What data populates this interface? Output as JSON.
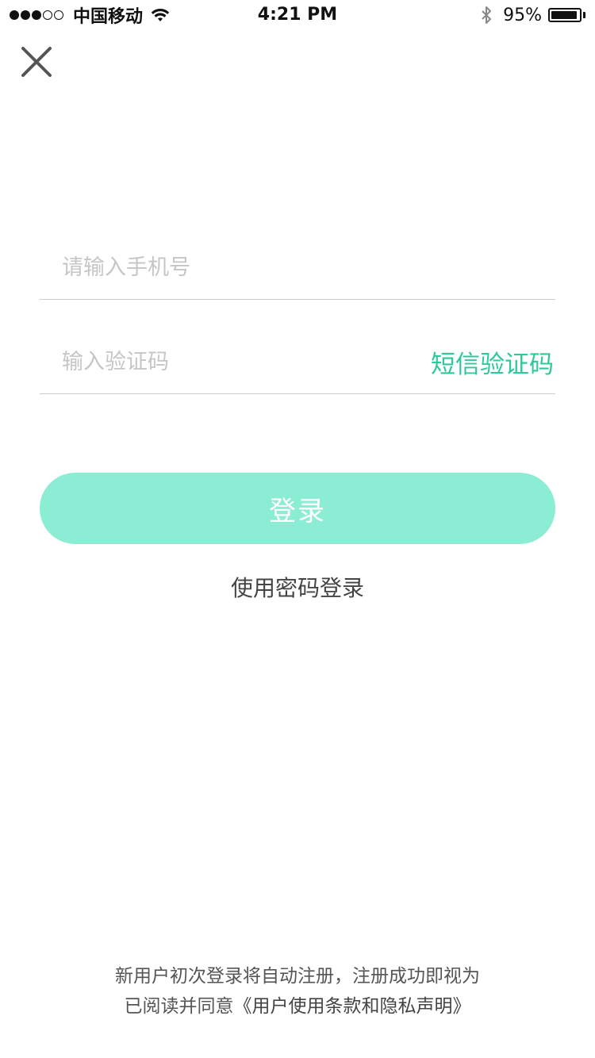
{
  "status_bar": {
    "carrier": "中国移动",
    "time": "4:21 PM",
    "battery_percent": "95%",
    "battery_level": 0.95,
    "signal_bars_filled": 3,
    "signal_bars_total": 5
  },
  "header": {
    "close_icon": "close-icon"
  },
  "form": {
    "phone_placeholder": "请输入手机号",
    "phone_value": "",
    "code_placeholder": "输入验证码",
    "code_value": "",
    "sms_code_label": "短信验证码",
    "login_label": "登录",
    "password_login_label": "使用密码登录"
  },
  "footer": {
    "agreement_line1": "新用户初次登录将自动注册，注册成功即视为",
    "agreement_prefix": "已阅读并同意",
    "terms_link": "《用户使用条款和隐私声明》"
  },
  "colors": {
    "accent": "#2ec89a",
    "button_bg": "#8bedd3",
    "placeholder": "#c6c6c6",
    "divider": "#cccccc"
  }
}
